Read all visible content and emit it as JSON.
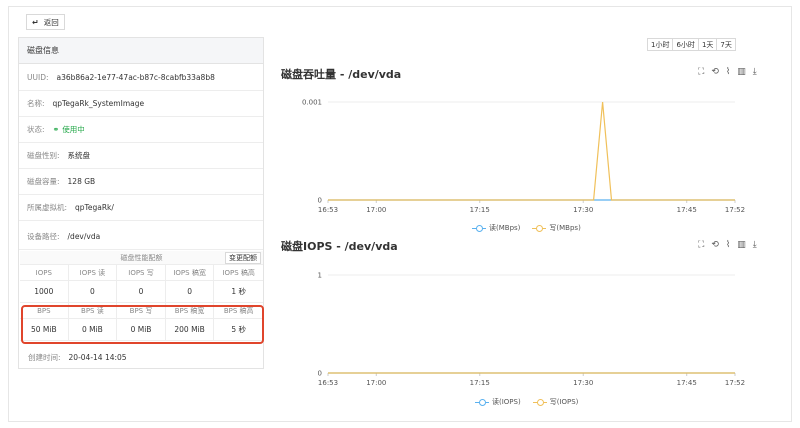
{
  "back_label": "返回",
  "panel": {
    "title": "磁盘信息",
    "uuid": {
      "label": "UUID:",
      "value": "a36b86a2-1e77-47ac-b87c-8cabfb33a8b8"
    },
    "name": {
      "label": "名称:",
      "value": "qpTegaRk_SystemImage"
    },
    "status": {
      "label": "状态:",
      "value": "使用中"
    },
    "type": {
      "label": "磁盘性别:",
      "value": "系统盘"
    },
    "capacity": {
      "label": "磁盘容量:",
      "value": "128 GB"
    },
    "vm": {
      "label": "所属虚拟机:",
      "value": "qpTegaRk/"
    },
    "path": {
      "label": "设备路径:",
      "value": "/dev/vda"
    },
    "spec_title": "磁盘性能配额",
    "change_label": "变更配额",
    "iops_headers": [
      "IOPS",
      "IOPS 读",
      "IOPS 写",
      "IOPS 稿宽",
      "IOPS 稿高"
    ],
    "iops_values": [
      "1000",
      "0",
      "0",
      "0",
      "1 秒"
    ],
    "bps_headers": [
      "BPS",
      "BPS 读",
      "BPS 写",
      "BPS 稿宽",
      "BPS 稿高"
    ],
    "bps_values": [
      "50 MiB",
      "0 MiB",
      "0 MiB",
      "200 MiB",
      "5 秒"
    ],
    "created": {
      "label": "创建时间:",
      "value": "20-04-14 14:05"
    }
  },
  "time_ranges": [
    "1小时",
    "6小时",
    "1天",
    "7天"
  ],
  "colors": {
    "read": "#5ab1ef",
    "write": "#f0c05a",
    "axis": "#cccccc",
    "highlight": "#e0452c",
    "ok": "#25a84a"
  },
  "tool_icons": [
    "zoom-icon",
    "zoom-reset-icon",
    "line-chart-icon",
    "bar-chart-icon",
    "download-icon"
  ],
  "chart_data": [
    {
      "type": "line",
      "title": "磁盘吞吐量 - /dev/vda",
      "x": [
        "16:53",
        "17:00",
        "17:15",
        "17:30",
        "17:45",
        "17:52"
      ],
      "x_minutes": [
        0,
        7,
        22,
        37,
        52,
        59
      ],
      "ytick_labels": [
        "0",
        "0.001"
      ],
      "ylim": [
        0,
        0.001
      ],
      "series": [
        {
          "name": "读(MBps)",
          "color": "#5ab1ef",
          "points": [
            [
              0,
              0
            ],
            [
              59,
              0
            ]
          ]
        },
        {
          "name": "写(MBps)",
          "color": "#f0c05a",
          "points": [
            [
              0,
              0
            ],
            [
              38.5,
              0
            ],
            [
              39.8,
              0.001
            ],
            [
              41.1,
              0
            ],
            [
              59,
              0
            ]
          ]
        }
      ]
    },
    {
      "type": "line",
      "title": "磁盘IOPS - /dev/vda",
      "x": [
        "16:53",
        "17:00",
        "17:15",
        "17:30",
        "17:45",
        "17:52"
      ],
      "x_minutes": [
        0,
        7,
        22,
        37,
        52,
        59
      ],
      "ytick_labels": [
        "0",
        "1"
      ],
      "ylim": [
        0,
        1
      ],
      "series": [
        {
          "name": "读(IOPS)",
          "color": "#5ab1ef",
          "points": [
            [
              0,
              0
            ],
            [
              59,
              0
            ]
          ]
        },
        {
          "name": "写(IOPS)",
          "color": "#f0c05a",
          "points": [
            [
              0,
              0
            ],
            [
              59,
              0
            ]
          ]
        }
      ]
    }
  ]
}
